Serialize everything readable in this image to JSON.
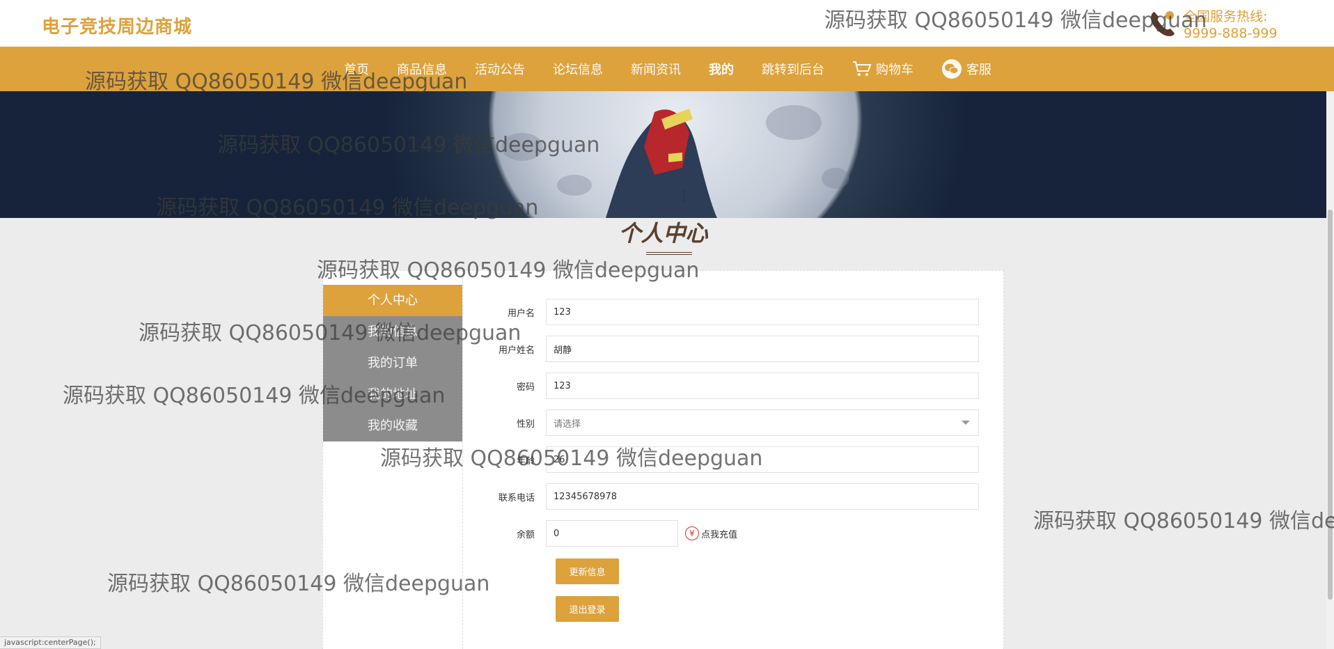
{
  "header": {
    "logo": "电子竞技周边商城",
    "hotline_label": "全国服务热线:",
    "hotline_number": "9999-888-999"
  },
  "nav": {
    "items": [
      {
        "label": "首页",
        "icon": ""
      },
      {
        "label": "商品信息",
        "icon": ""
      },
      {
        "label": "活动公告",
        "icon": ""
      },
      {
        "label": "论坛信息",
        "icon": ""
      },
      {
        "label": "新闻资讯",
        "icon": ""
      },
      {
        "label": "我的",
        "icon": "",
        "active": true
      },
      {
        "label": "跳转到后台",
        "icon": ""
      },
      {
        "label": "购物车",
        "icon": "cart-icon"
      },
      {
        "label": "客服",
        "icon": "wechat-icon"
      }
    ]
  },
  "page": {
    "title": "个人中心"
  },
  "sidebar": {
    "items": [
      {
        "label": "个人中心"
      },
      {
        "label": "我的信息"
      },
      {
        "label": "我的订单"
      },
      {
        "label": "我的地址"
      },
      {
        "label": "我的收藏"
      }
    ]
  },
  "form": {
    "username_label": "用户名",
    "username_value": "123",
    "realname_label": "用户姓名",
    "realname_value": "胡静",
    "password_label": "密码",
    "password_value": "123",
    "gender_label": "性别",
    "gender_placeholder": "请选择",
    "age_label": "年龄",
    "age_value": "26",
    "phone_label": "联系电话",
    "phone_value": "12345678978",
    "balance_label": "余额",
    "balance_value": "0",
    "recharge_label": "点我充值",
    "recharge_icon": "¥",
    "update_button": "更新信息",
    "logout_button": "退出登录"
  },
  "watermark": {
    "text": "源码获取 QQ86050149 微信deepguan"
  },
  "status_bar": {
    "text": "javascript:centerPage();"
  },
  "colors": {
    "accent": "#dda23c",
    "sidebar_bg": "#8c8c8c",
    "page_bg": "#ececec"
  }
}
